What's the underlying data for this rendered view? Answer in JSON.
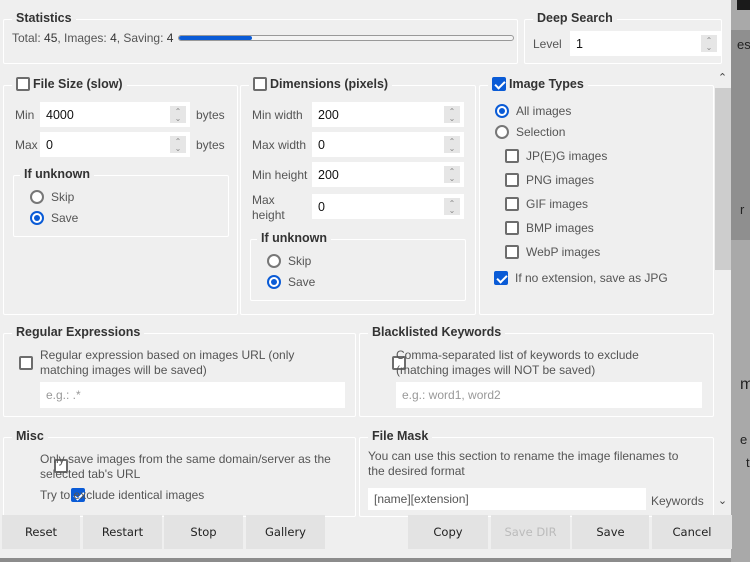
{
  "statistics": {
    "title": "Statistics",
    "summary_prefix_total": "Total: ",
    "total": "45",
    "sep_images": ", Images: ",
    "images": "4",
    "sep_saving": ", Saving: ",
    "saving": "4",
    "progress_fraction": 0.22
  },
  "deep_search": {
    "title": "Deep Search",
    "level_label": "Level",
    "level_value": "1"
  },
  "file_size": {
    "title": "File Size (slow)",
    "enabled": false,
    "min_label": "Min",
    "min_value": "4000",
    "max_label": "Max",
    "max_value": "0",
    "unit": "bytes",
    "if_unknown": {
      "title": "If unknown",
      "options": [
        "Skip",
        "Save"
      ],
      "selected": "Save"
    }
  },
  "dimensions": {
    "title": "Dimensions (pixels)",
    "enabled": false,
    "min_width_label": "Min width",
    "min_width": "200",
    "max_width_label": "Max width",
    "max_width": "0",
    "min_height_label": "Min height",
    "min_height": "200",
    "max_height_label_1": "Max",
    "max_height_label_2": "height",
    "max_height": "0",
    "if_unknown": {
      "title": "If unknown",
      "options": [
        "Skip",
        "Save"
      ],
      "selected": "Save"
    }
  },
  "image_types": {
    "title": "Image Types",
    "enabled": true,
    "mode_options": [
      "All images",
      "Selection"
    ],
    "mode_selected": "All images",
    "types": [
      {
        "label": "JP(E)G images",
        "checked": false
      },
      {
        "label": "PNG images",
        "checked": false
      },
      {
        "label": "GIF images",
        "checked": false
      },
      {
        "label": "BMP images",
        "checked": false
      },
      {
        "label": "WebP images",
        "checked": false
      }
    ],
    "no_extension_label": "If no extension, save as JPG",
    "no_extension_checked": true
  },
  "regex": {
    "title": "Regular Expressions",
    "checkbox_label_1": "Regular expression based on images URL (only",
    "checkbox_label_2": "matching images will be saved)",
    "checked": false,
    "placeholder": "e.g.: .*",
    "value": ""
  },
  "blacklist": {
    "title": "Blacklisted Keywords",
    "checkbox_label_1": "Comma-separated list of keywords to exclude",
    "checkbox_label_2": "(matching images will NOT be saved)",
    "checked": false,
    "placeholder": "e.g.: word1, word2",
    "value": ""
  },
  "misc": {
    "title": "Misc",
    "same_domain_label_1": "Only save images from the same domain/server as the",
    "same_domain_label_2": "selected tab's URL",
    "same_domain_checked": false,
    "exclude_identical_label": "Try to exclude identical images",
    "exclude_identical_checked": true
  },
  "file_mask": {
    "title": "File Mask",
    "description_1": "You can use this section to rename the image filenames to",
    "description_2": "the desired format",
    "value": "[name][extension]",
    "keywords_label": "Keywords"
  },
  "buttons": {
    "reset": "Reset",
    "restart": "Restart",
    "stop": "Stop",
    "gallery": "Gallery",
    "copy": "Copy",
    "save_dir": "Save DIR",
    "save": "Save",
    "cancel": "Cancel"
  },
  "scrollbar": {
    "thumb_start_fraction": 0.0,
    "thumb_size_fraction": 0.45
  },
  "backdrop": {
    "fragment_1": "es",
    "fragment_2": "r",
    "fragment_3": "m",
    "fragment_4": "e",
    "fragment_5": "t"
  },
  "colors": {
    "accent": "#0a5bd6",
    "dialog_bg": "#efefef",
    "button_bg": "#e3e3e3"
  }
}
